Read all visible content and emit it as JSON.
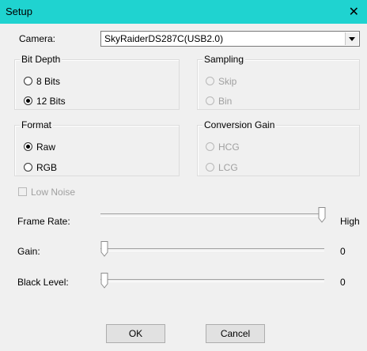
{
  "window": {
    "title": "Setup"
  },
  "camera": {
    "label": "Camera:",
    "value": "SkyRaiderDS287C(USB2.0)"
  },
  "bit_depth": {
    "title": "Bit Depth",
    "options": [
      "8 Bits",
      "12 Bits"
    ],
    "selected": "12 Bits"
  },
  "sampling": {
    "title": "Sampling",
    "options": [
      "Skip",
      "Bin"
    ],
    "enabled": false
  },
  "format": {
    "title": "Format",
    "options": [
      "Raw",
      "RGB"
    ],
    "selected": "Raw"
  },
  "conversion_gain": {
    "title": "Conversion Gain",
    "options": [
      "HCG",
      "LCG"
    ],
    "enabled": false
  },
  "low_noise": {
    "label": "Low Noise",
    "checked": false,
    "enabled": false
  },
  "frame_rate": {
    "label": "Frame Rate:",
    "value_text": "High",
    "level": 1.0
  },
  "gain": {
    "label": "Gain:",
    "value_text": "0",
    "level": 0.0
  },
  "black_level": {
    "label": "Black Level:",
    "value_text": "0",
    "level": 0.0
  },
  "buttons": {
    "ok": "OK",
    "cancel": "Cancel"
  }
}
